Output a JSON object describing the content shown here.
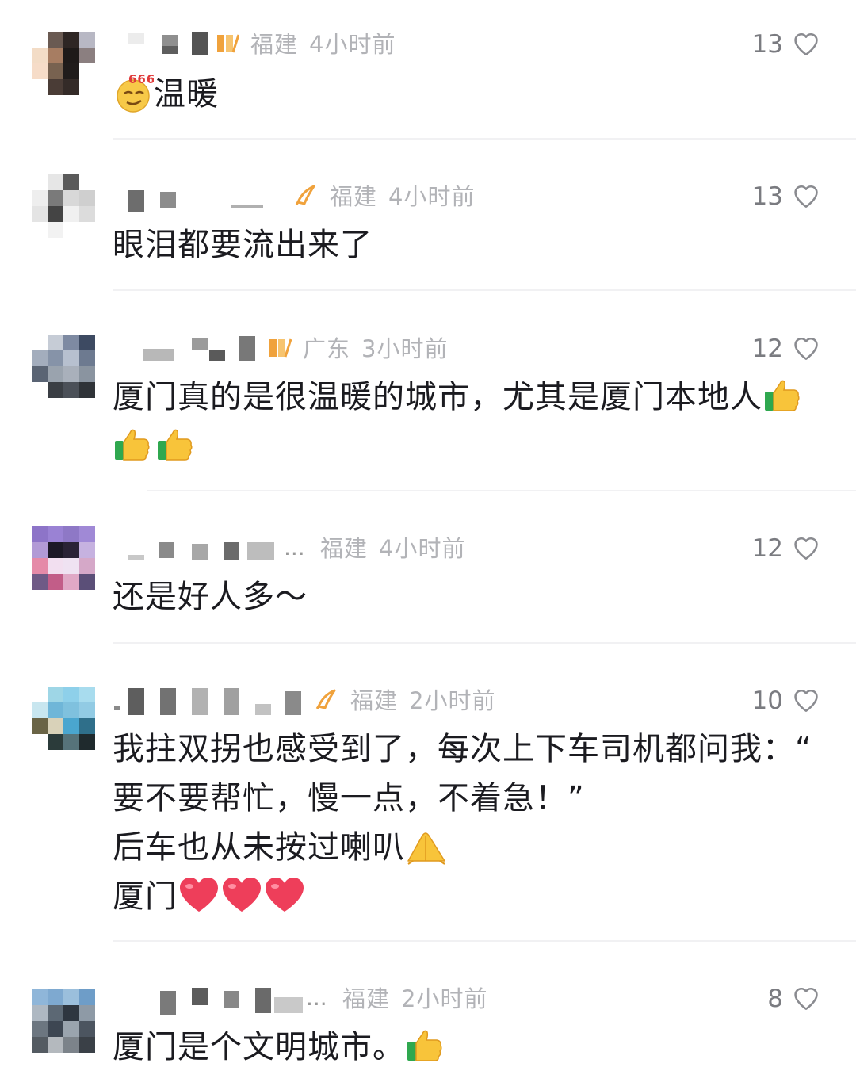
{
  "comments": [
    {
      "location": "福建",
      "time": "4小时前",
      "likes": "13",
      "lines": [
        "温暖"
      ]
    },
    {
      "location": "福建",
      "time": "4小时前",
      "likes": "13",
      "lines": [
        "眼泪都要流出来了"
      ]
    },
    {
      "location": "广东",
      "time": "3小时前",
      "likes": "12",
      "lines": [
        "厦门真的是很温暖的城市，尤其是厦门本地人"
      ]
    },
    {
      "location": "福建",
      "time": "4小时前",
      "likes": "12",
      "lines": [
        "还是好人多～"
      ]
    },
    {
      "location": "福建",
      "time": "2小时前",
      "likes": "10",
      "lines": [
        "我拄双拐也感受到了，每次上下车司机都问我：“",
        "要不要帮忙，慢一点，不着急！”",
        "后车也从未按过喇叭",
        "厦门"
      ]
    },
    {
      "location": "福建",
      "time": "2小时前",
      "likes": "8",
      "lines": [
        "厦门是个文明城市。"
      ]
    }
  ],
  "emoji_sticker_text": "666",
  "name_ellipsis": "...",
  "icons": {
    "like": "heart-outline-icon",
    "badge_orange": "orange-level-badge-icon",
    "badge_fan": "orange-fan-badge-icon",
    "emoji_666": "666-face-emoji",
    "emoji_thumbs": "thumbs-up-emoji",
    "emoji_clap": "prayer-hands-emoji",
    "emoji_heart": "red-heart-emoji"
  },
  "colors": {
    "meta_text": "#b2b3b7",
    "like_count": "#7a7b80",
    "badge": "#f0a23c",
    "heart_emoji": "#ee3e5a"
  }
}
